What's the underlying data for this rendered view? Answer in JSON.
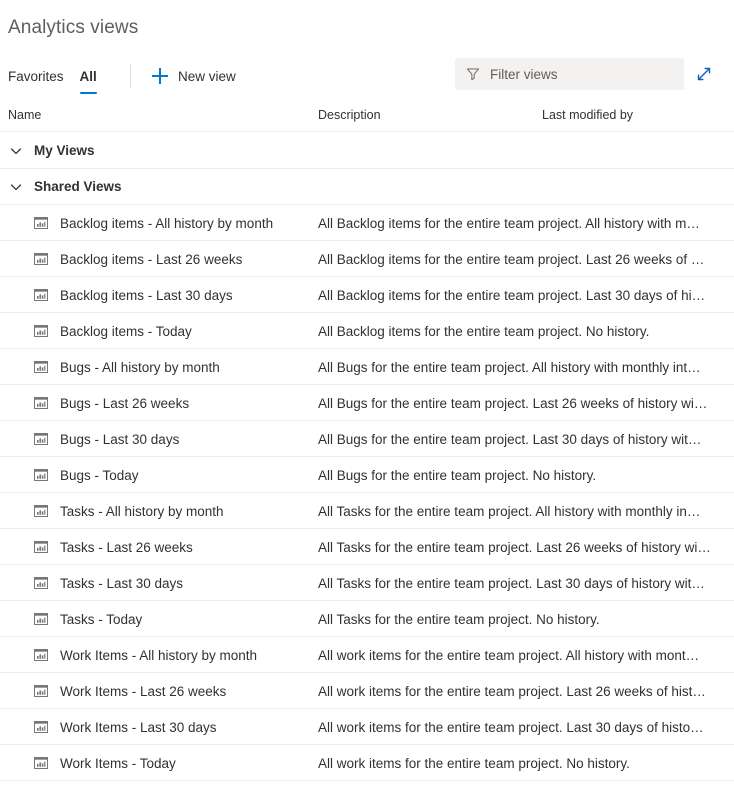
{
  "header": {
    "title": "Analytics views"
  },
  "commandbar": {
    "tabs": [
      {
        "label": "Favorites",
        "selected": false
      },
      {
        "label": "All",
        "selected": true
      }
    ],
    "new_view_label": "New view",
    "plus_icon": "plus-icon",
    "expand_icon": "expand-diagonal-icon"
  },
  "filter": {
    "icon": "funnel-icon",
    "value": "",
    "placeholder": "Filter views"
  },
  "columns": {
    "name": "Name",
    "description": "Description",
    "last_modified_by": "Last modified by"
  },
  "colors": {
    "accent": "#0078d4",
    "text": "#323130",
    "subtle_text": "#605e5c",
    "row_border": "#edebe9",
    "filter_bg": "#f3f2f1"
  },
  "groups": [
    {
      "label": "My Views",
      "expanded": true,
      "chevron": "chevron-down-icon",
      "rows": []
    },
    {
      "label": "Shared Views",
      "expanded": true,
      "chevron": "chevron-down-icon",
      "rows": [
        {
          "icon": "analytics-view-icon",
          "name": "Backlog items - All history by month",
          "description": "All Backlog items for the entire team project. All history with m…",
          "last_modified_by": ""
        },
        {
          "icon": "analytics-view-icon",
          "name": "Backlog items - Last 26 weeks",
          "description": "All Backlog items for the entire team project. Last 26 weeks of …",
          "last_modified_by": ""
        },
        {
          "icon": "analytics-view-icon",
          "name": "Backlog items - Last 30 days",
          "description": "All Backlog items for the entire team project. Last 30 days of hi…",
          "last_modified_by": ""
        },
        {
          "icon": "analytics-view-icon",
          "name": "Backlog items - Today",
          "description": "All Backlog items for the entire team project. No history.",
          "last_modified_by": ""
        },
        {
          "icon": "analytics-view-icon",
          "name": "Bugs - All history by month",
          "description": "All Bugs for the entire team project. All history with monthly int…",
          "last_modified_by": ""
        },
        {
          "icon": "analytics-view-icon",
          "name": "Bugs - Last 26 weeks",
          "description": "All Bugs for the entire team project. Last 26 weeks of history wi…",
          "last_modified_by": ""
        },
        {
          "icon": "analytics-view-icon",
          "name": "Bugs - Last 30 days",
          "description": "All Bugs for the entire team project. Last 30 days of history wit…",
          "last_modified_by": ""
        },
        {
          "icon": "analytics-view-icon",
          "name": "Bugs - Today",
          "description": "All Bugs for the entire team project. No history.",
          "last_modified_by": ""
        },
        {
          "icon": "analytics-view-icon",
          "name": "Tasks - All history by month",
          "description": "All Tasks for the entire team project. All history with monthly in…",
          "last_modified_by": ""
        },
        {
          "icon": "analytics-view-icon",
          "name": "Tasks - Last 26 weeks",
          "description": "All Tasks for the entire team project. Last 26 weeks of history wi…",
          "last_modified_by": ""
        },
        {
          "icon": "analytics-view-icon",
          "name": "Tasks - Last 30 days",
          "description": "All Tasks for the entire team project. Last 30 days of history wit…",
          "last_modified_by": ""
        },
        {
          "icon": "analytics-view-icon",
          "name": "Tasks - Today",
          "description": "All Tasks for the entire team project. No history.",
          "last_modified_by": ""
        },
        {
          "icon": "analytics-view-icon",
          "name": "Work Items - All history by month",
          "description": "All work items for the entire team project. All history with mont…",
          "last_modified_by": ""
        },
        {
          "icon": "analytics-view-icon",
          "name": "Work Items - Last 26 weeks",
          "description": "All work items for the entire team project. Last 26 weeks of hist…",
          "last_modified_by": ""
        },
        {
          "icon": "analytics-view-icon",
          "name": "Work Items - Last 30 days",
          "description": "All work items for the entire team project. Last 30 days of histo…",
          "last_modified_by": ""
        },
        {
          "icon": "analytics-view-icon",
          "name": "Work Items - Today",
          "description": "All work items for the entire team project. No history.",
          "last_modified_by": ""
        }
      ]
    }
  ]
}
